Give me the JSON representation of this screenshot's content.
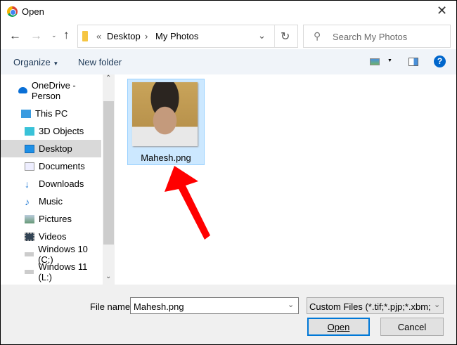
{
  "window": {
    "title": "Open"
  },
  "address": {
    "overflow": "«",
    "crumbs": [
      "Desktop",
      "My Photos"
    ]
  },
  "search": {
    "placeholder": "Search My Photos"
  },
  "toolbar": {
    "organize": "Organize",
    "new_folder": "New folder",
    "help": "?"
  },
  "sidebar": {
    "items": [
      {
        "label": "OneDrive - Person",
        "icon": "onedrive-icon"
      },
      {
        "label": "This PC",
        "icon": "pc-icon"
      },
      {
        "label": "3D Objects",
        "icon": "cube-icon"
      },
      {
        "label": "Desktop",
        "icon": "desktop-icon",
        "selected": true
      },
      {
        "label": "Documents",
        "icon": "documents-icon"
      },
      {
        "label": "Downloads",
        "icon": "download-icon"
      },
      {
        "label": "Music",
        "icon": "music-icon"
      },
      {
        "label": "Pictures",
        "icon": "pictures-icon"
      },
      {
        "label": "Videos",
        "icon": "videos-icon"
      },
      {
        "label": "Windows 10 (C:)",
        "icon": "drive-icon"
      },
      {
        "label": "Windows 11 (L:)",
        "icon": "drive-icon"
      }
    ]
  },
  "files": [
    {
      "name": "Mahesh.png"
    }
  ],
  "footer": {
    "file_name_label": "File name:",
    "file_name_value": "Mahesh.png",
    "filter": "Custom Files (*.tif;*.pjp;*.xbm;*.",
    "open": "Open",
    "cancel": "Cancel"
  },
  "colors": {
    "accent": "#0078d7",
    "arrow": "#ff0000",
    "selection": "#cce8ff"
  }
}
